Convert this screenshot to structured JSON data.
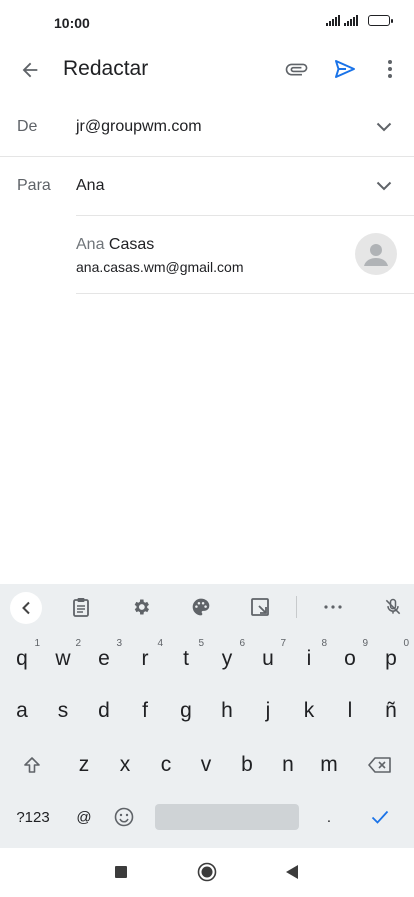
{
  "status_bar": {
    "time": "10:00",
    "icons": [
      "signal-icon",
      "signal-icon",
      "battery-icon"
    ]
  },
  "app_bar": {
    "title": "Redactar",
    "icons": [
      "back-arrow-icon",
      "paperclip-icon",
      "send-icon",
      "more-vert-icon"
    ],
    "accent_color": "#1a73e8"
  },
  "from": {
    "label": "De",
    "value": "jr@groupwm.com"
  },
  "to": {
    "label": "Para",
    "value": "Ana"
  },
  "suggestion": {
    "name_match": "Ana",
    "name_rest": " Casas",
    "email": "ana.casas.wm@gmail.com"
  },
  "keyboard": {
    "toolbar_icons": [
      "chevron-left-icon",
      "clipboard-icon",
      "gear-icon",
      "palette-icon",
      "resize-icon",
      "more-horiz-icon",
      "mic-off-icon"
    ],
    "row1": [
      {
        "key": "q",
        "hint": "1"
      },
      {
        "key": "w",
        "hint": "2"
      },
      {
        "key": "e",
        "hint": "3"
      },
      {
        "key": "r",
        "hint": "4"
      },
      {
        "key": "t",
        "hint": "5"
      },
      {
        "key": "y",
        "hint": "6"
      },
      {
        "key": "u",
        "hint": "7"
      },
      {
        "key": "i",
        "hint": "8"
      },
      {
        "key": "o",
        "hint": "9"
      },
      {
        "key": "p",
        "hint": "0"
      }
    ],
    "row2": [
      "a",
      "s",
      "d",
      "f",
      "g",
      "h",
      "j",
      "k",
      "l",
      "ñ"
    ],
    "row3": [
      "z",
      "x",
      "c",
      "v",
      "b",
      "n",
      "m"
    ],
    "row4": {
      "symbols": "?123",
      "at": "@",
      "period": "."
    },
    "icons": [
      "shift-icon",
      "backspace-icon",
      "emoji-icon",
      "checkmark-icon"
    ],
    "background_color": "#eceff1"
  },
  "nav_bar": {
    "icons": [
      "recents-square-icon",
      "home-circle-icon",
      "back-triangle-icon"
    ]
  }
}
